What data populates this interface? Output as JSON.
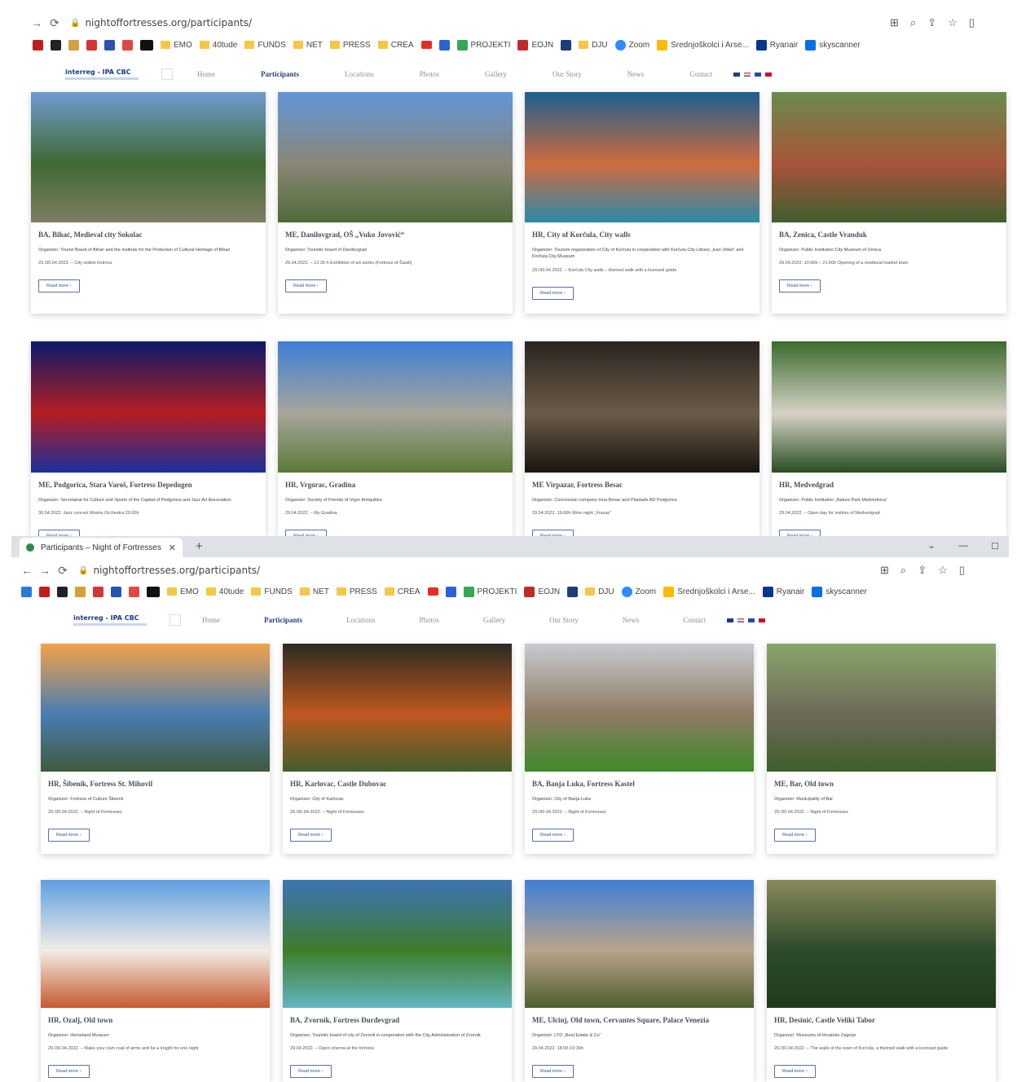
{
  "browser": {
    "url": "nightoffortresses.org/participants/",
    "tab_title": "Participants – Night of Fortresses",
    "tab_close": "✕",
    "new_tab": "+",
    "bookmarks": [
      "EMO",
      "40tude",
      "FUNDS",
      "NET",
      "PRESS",
      "CREA",
      "PROJEKTI",
      "EOJN",
      "DJU",
      "Zoom",
      "Srednjoškolci i Arse...",
      "Ryanair",
      "skyscanner"
    ]
  },
  "site": {
    "logo_text": "interreg - IPA CBC",
    "nav": [
      "Home",
      "Participants",
      "Locations",
      "Photos",
      "Gallery",
      "Our Story",
      "News",
      "Contact"
    ],
    "active_nav": "Participants"
  },
  "cards_a": [
    {
      "title": "BA, Bihać, Medieval city Sokolac",
      "org": "Organizer: Tourist Board of Bihać and the Institute for the Protection of Cultural Heritage of Bihać",
      "event": "29./30.04.2022. – City visible fortress",
      "btn": "Read more ›",
      "colors": [
        "#6f9bd1",
        "#3f6a32",
        "#7e7d62"
      ]
    },
    {
      "title": "ME, Danilovgrad, OŠ „Vuko Jovović“",
      "org": "Organizer: Touristic board of Danilovgrad",
      "event": "29.04.2022. – 12:30 h Exhibition of art works (Fortress of Šauši)",
      "btn": "Read more ›",
      "colors": [
        "#5f95d8",
        "#8b8676",
        "#4e6b3a"
      ]
    },
    {
      "title": "HR, City of Korčula, City walls",
      "org": "Organizer: Tourism organization of City of Korčula in cooperation with Korčula City Library „Ivan Vidali“ and Korčula City Museum",
      "event": "29./30.04.2022. – Korčula City walls – themed walk with a licensed guide",
      "btn": "Read more ›",
      "colors": [
        "#1b5f8f",
        "#d06b3e",
        "#2a8aa9"
      ]
    },
    {
      "title": "BA, Zenica, Castle Vranduk",
      "org": "Organizer: Public Institution City Museum of Zenica",
      "event": "29.04.2022. 10:00h – 21:00h Opening of a medieval market town",
      "btn": "Read more ›",
      "colors": [
        "#6a8c4c",
        "#a7543a",
        "#3f5e2e"
      ]
    },
    {
      "title": "ME, Podgorica, Stara Varoš, Fortress Depedogen",
      "org": "Organizer: Secretariat for Culture and Sports of the Capital of Podgorica and Jazz Art Association",
      "event": "30.04.2022. Jazz concert Mirsha Orchestra 20:00h",
      "btn": "Read more ›",
      "colors": [
        "#0b1a6a",
        "#b41e22",
        "#1a2f9a"
      ]
    },
    {
      "title": "HR, Vrgorac, Gradina",
      "org": "Organizer: Society of Friends of Vrgor Antiquities",
      "event": "29.04.2022. – My Gradina",
      "btn": "Read more ›",
      "colors": [
        "#3d7fd6",
        "#a8a59a",
        "#5b7a3a"
      ]
    },
    {
      "title": "ME Virpazar, Fortress Besac",
      "org": "Organizer: Concession company Inna Besac and Plantaže AD Podgorica",
      "event": "29.04.2022. 19:00h Wine night „Vranac“",
      "btn": "Read more ›",
      "colors": [
        "#2a2320",
        "#6b5c48",
        "#1a1510"
      ]
    },
    {
      "title": "HR, Medvedgrad",
      "org": "Organizer: Public Institution „Nature Park Medvednica“",
      "event": "29.04.2022. – Open day for visitors of Medvedgrad",
      "btn": "Read more ›",
      "colors": [
        "#3b6b2c",
        "#d6d2c6",
        "#284d22"
      ]
    }
  ],
  "cards_b": [
    {
      "title": "HR, Šibenik, Fortress St. Mihovil",
      "org": "Organizer: Fortress of Culture Šibenik",
      "event": "29./30.04.2022. – Night of Fortresses",
      "btn": "Read more ›",
      "colors": [
        "#f1a24a",
        "#4a7db1",
        "#3f5a3c"
      ]
    },
    {
      "title": "HR, Karlovac, Castle Dubovac",
      "org": "Organizer: City of Karlovac",
      "event": "29./30.04.2022. – Night of Fortresses",
      "btn": "Read more ›",
      "colors": [
        "#2b2a22",
        "#c0581f",
        "#405f2c"
      ]
    },
    {
      "title": "BA, Banja Luka, Fortress Kastel",
      "org": "Organizer: City of Banja Luka",
      "event": "29./30.04.2022. – Night of Fortresses",
      "btn": "Read more ›",
      "colors": [
        "#c7cbd0",
        "#8e7b64",
        "#3f8a2a"
      ]
    },
    {
      "title": "ME, Bar, Old town",
      "org": "Organizer: Municipality of Bar",
      "event": "29./30.04.2022. – Night of Fortresses",
      "btn": "Read more ›",
      "colors": [
        "#89a56a",
        "#6e6a5a",
        "#3f5f2a"
      ]
    },
    {
      "title": "HR, Ozalj, Old town",
      "org": "Organizer: Homeland Museum",
      "event": "29./30.04.2022. – Make your own coat of arms and be a knight for one night",
      "btn": "Read more ›",
      "colors": [
        "#5d9fe0",
        "#f2ede6",
        "#c65a2e"
      ]
    },
    {
      "title": "BA, Zvornik, Fortress Đurđevgrad",
      "org": "Organizer: Touristic board of city of Zvornik in cooperation with the City Administration of Zvornik",
      "event": "29.04.2022. – Open cinema at the fortress",
      "btn": "Read more ›",
      "colors": [
        "#3c74b5",
        "#3f7d2b",
        "#63b5c0"
      ]
    },
    {
      "title": "ME, Ulcinj, Old town, Cervantes Square, Palace Venezia",
      "org": "Organizer: LTD „Real Estate & Co“",
      "event": "29.04.2022. 18:00-19:30h",
      "btn": "Read more ›",
      "colors": [
        "#3f7fd6",
        "#b8a48a",
        "#4f5e2e"
      ]
    },
    {
      "title": "HR, Desinić, Castle Veliki Tabor",
      "org": "Organizer: Museums of Hrvatsko Zagorje",
      "event": "29./30.04.2022. – The walls of the town of Korčula, a themed walk with a licensed guide",
      "btn": "Read more ›",
      "colors": [
        "#8a8a5a",
        "#2d4a2c",
        "#1f3a1e"
      ]
    }
  ]
}
